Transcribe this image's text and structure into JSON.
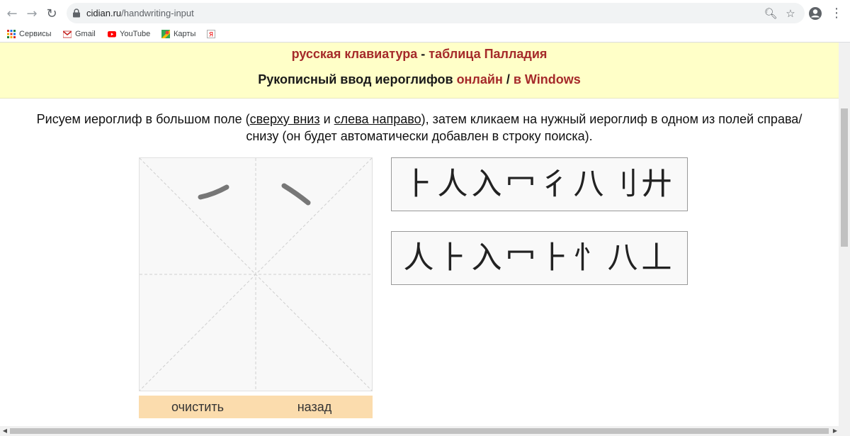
{
  "browser": {
    "url_host": "cidian.ru",
    "url_path": "/handwriting-input",
    "bookmarks": [
      {
        "label": "Сервисы",
        "icon": "apps-grid-icon"
      },
      {
        "label": "Gmail",
        "icon": "gmail-icon"
      },
      {
        "label": "YouTube",
        "icon": "youtube-icon"
      },
      {
        "label": "Карты",
        "icon": "maps-icon"
      },
      {
        "label": "",
        "icon": "yandex-icon"
      }
    ]
  },
  "header": {
    "link_keyboard": "русская клавиатура",
    "sep1": " - ",
    "link_palladius": "таблица Палладия",
    "title_text": "Рукописный ввод иероглифов ",
    "link_online": "онлайн",
    "sep2": " / ",
    "link_windows": "в Windows"
  },
  "instructions": {
    "part1": "Рисуем иероглиф в большом поле (",
    "link_top_down": "сверху вниз",
    "part2": " и ",
    "link_left_right": "слева направо",
    "part3": "), затем кликаем на нужный иероглиф в одном из полей справа/",
    "line2": "снизу (он будет автоматически добавлен в строку поиска)."
  },
  "canvas_buttons": {
    "clear": "очистить",
    "back": "назад"
  },
  "candidates": {
    "row1": [
      "⺊",
      "人",
      "入",
      "冖",
      "彳",
      "八",
      "刂",
      "廾"
    ],
    "row2": [
      "人",
      "⺊",
      "入",
      "冖",
      "⺊",
      "忄",
      "八",
      "丄"
    ]
  },
  "colors": {
    "header_bg": "#ffffc8",
    "link_red": "#a52a2a",
    "button_bar": "#fbdcad"
  }
}
